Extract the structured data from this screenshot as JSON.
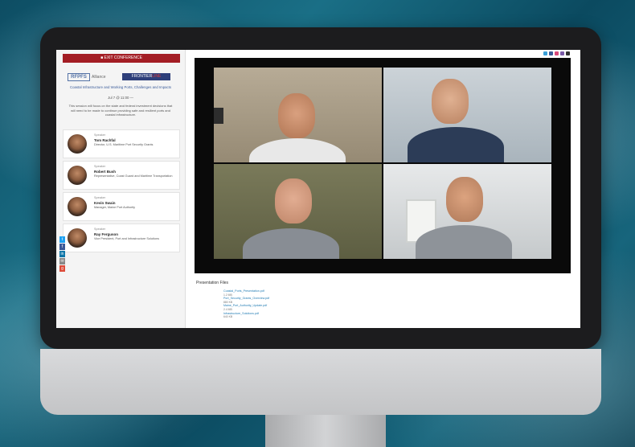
{
  "sidebar": {
    "exit_label": "■ EXIT CONFERENCE",
    "logos": {
      "left": "RFPFS",
      "middle": "Alliance",
      "right_a": "FRONTIER",
      "right_b": "LINE"
    },
    "session_title": "Coastal Infrastructure and Working Ports, Challenges and Impacts",
    "session_date": "Jul 7 @ 11:00 —",
    "session_desc": "This session will focus on the state and federal investment decisions that will need to be made to continue providing safe and resilient ports and coastal infrastructure.",
    "speakers": [
      {
        "role": "Speaker",
        "name": "Tom Rachfal",
        "org": "Director, U.S. Maritime Port Security Grants"
      },
      {
        "role": "Speaker",
        "name": "Robert Bush",
        "org": "Representative, Coast Guard and Maritime Transportation"
      },
      {
        "role": "Speaker",
        "name": "Kevin Swain",
        "org": "Manager, Maine Port Authority"
      },
      {
        "role": "Speaker",
        "name": "Ray Ferguson",
        "org": "Vice President, Port and Infrastructure Solutions"
      }
    ],
    "share": [
      {
        "icon": "twitter-icon",
        "glyph": "t",
        "color": "#1da1f2"
      },
      {
        "icon": "facebook-icon",
        "glyph": "f",
        "color": "#3b5998"
      },
      {
        "icon": "linkedin-icon",
        "glyph": "in",
        "color": "#0e76a8"
      },
      {
        "icon": "email-icon",
        "glyph": "✉",
        "color": "#888888"
      },
      {
        "icon": "google-plus-icon",
        "glyph": "g",
        "color": "#dd4b39"
      }
    ]
  },
  "main": {
    "presentation_title": "Presentation Files",
    "files": [
      {
        "name": "Coastal_Ports_Presentation.pdf",
        "size": "1.2 MB"
      },
      {
        "name": "Port_Security_Grants_Overview.pdf",
        "size": "880 KB"
      },
      {
        "name": "Maine_Port_Authority_Update.pdf",
        "size": "2.4 MB"
      },
      {
        "name": "Infrastructure_Solutions.pdf",
        "size": "640 KB"
      }
    ]
  },
  "colors": {
    "brand_red": "#a31d24",
    "link_blue": "#1f7ab3"
  }
}
